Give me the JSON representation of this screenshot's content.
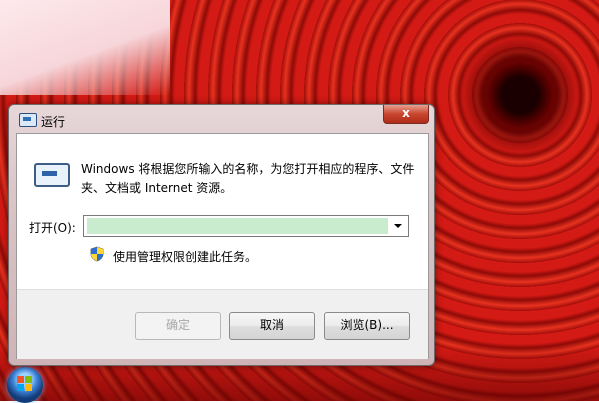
{
  "window": {
    "title": "运行",
    "close_glyph": "x",
    "description": "Windows 将根据您所输入的名称，为您打开相应的程序、文件夹、文档或 Internet 资源。",
    "open_label": "打开(O):",
    "open_value": "",
    "admin_text": "使用管理权限创建此任务。",
    "buttons": {
      "ok": "确定",
      "cancel": "取消",
      "browse": "浏览(B)..."
    }
  },
  "icons": {
    "title": "run-icon",
    "dialog": "run-icon",
    "admin": "shield-icon",
    "taskbar": "windows-start-icon"
  },
  "colors": {
    "input_highlight": "#c9ecce",
    "close_button": "#c8452f",
    "wallpaper": "#b41010"
  }
}
